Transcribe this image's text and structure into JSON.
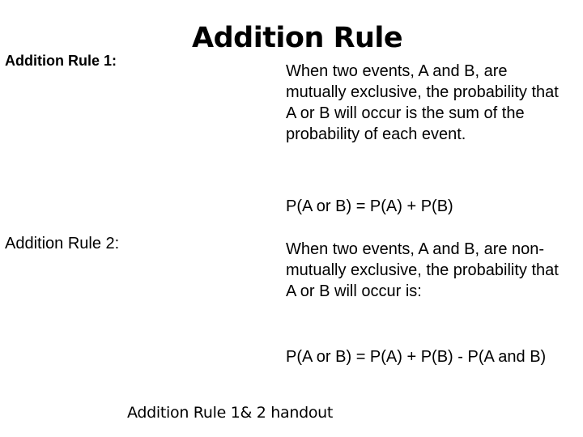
{
  "slide": {
    "title": "Addition Rule",
    "rule1": {
      "label": "Addition Rule 1:",
      "description": "When two events, A and B, are mutually exclusive, the probability that A or B will occur is the sum of the probability of each event.",
      "formula": "P(A or B) = P(A) + P(B)"
    },
    "rule2": {
      "label": "Addition Rule 2:",
      "description": "When two events, A and B, are non-mutually exclusive, the probability that A or B will occur is:",
      "formula": "P(A or B) = P(A) + P(B) - P(A and B)"
    },
    "footer": "Addition Rule 1& 2 handout"
  }
}
